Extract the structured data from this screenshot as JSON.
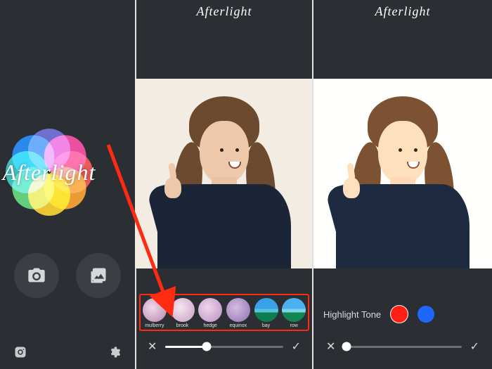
{
  "brand_name": "Afterlight",
  "panel_home": {
    "camera_button": "camera",
    "library_button": "library",
    "instagram_button": "instagram",
    "settings_button": "settings"
  },
  "panel_filters": {
    "header": "Afterlight",
    "filters": [
      {
        "name": "mulberry"
      },
      {
        "name": "brook"
      },
      {
        "name": "hedge"
      },
      {
        "name": "equinox"
      },
      {
        "name": "bay"
      },
      {
        "name": "row"
      }
    ],
    "slider_value_pct": 35,
    "cancel": "✕",
    "confirm": "✓"
  },
  "panel_tone": {
    "header": "Afterlight",
    "adjust_label": "Highlight Tone",
    "tones": [
      {
        "color": "#ff1f12",
        "selected": true
      },
      {
        "color": "#1f67ff",
        "selected": false
      }
    ],
    "slider_value_pct": 2,
    "cancel": "✕",
    "confirm": "✓"
  },
  "color_wheel_hues": [
    "#ff3b30",
    "#ff9500",
    "#ffcc00",
    "#4cd964",
    "#1fc6c0",
    "#007aff",
    "#5856d6",
    "#ff2d92"
  ]
}
